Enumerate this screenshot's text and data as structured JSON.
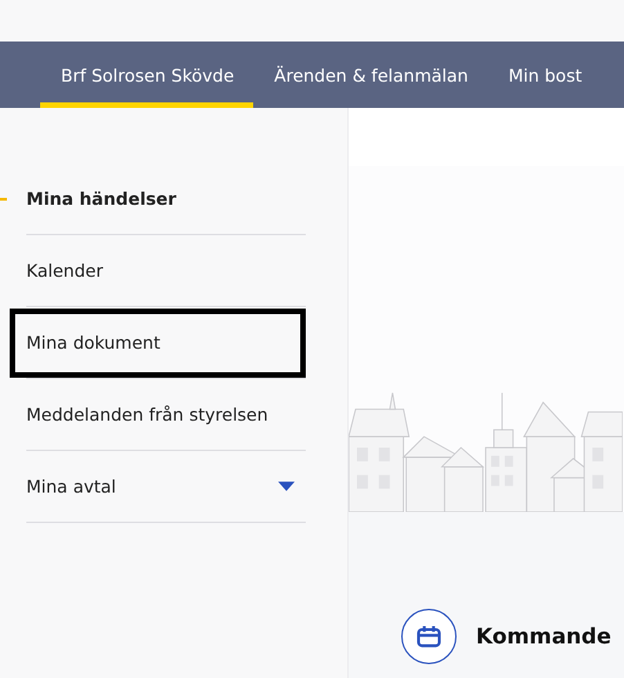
{
  "nav": {
    "tabs": [
      {
        "label": "Brf Solrosen Skövde",
        "selected": true
      },
      {
        "label": "Ärenden & felanmälan",
        "selected": false
      },
      {
        "label": "Min bost",
        "selected": false
      }
    ]
  },
  "sidebar": {
    "items": [
      {
        "kind": "link",
        "label": "Mina händelser",
        "selected": true,
        "focused": false
      },
      {
        "kind": "link",
        "label": "Kalender",
        "selected": false,
        "focused": false
      },
      {
        "kind": "link",
        "label": "Mina dokument",
        "selected": false,
        "focused": true
      },
      {
        "kind": "link",
        "label": "Meddelanden från styrelsen",
        "selected": false,
        "focused": false
      },
      {
        "kind": "dropdown",
        "label": "Mina avtal",
        "selected": false,
        "focused": false,
        "expanded": false
      }
    ]
  },
  "main": {
    "section_title": "Kommande"
  }
}
